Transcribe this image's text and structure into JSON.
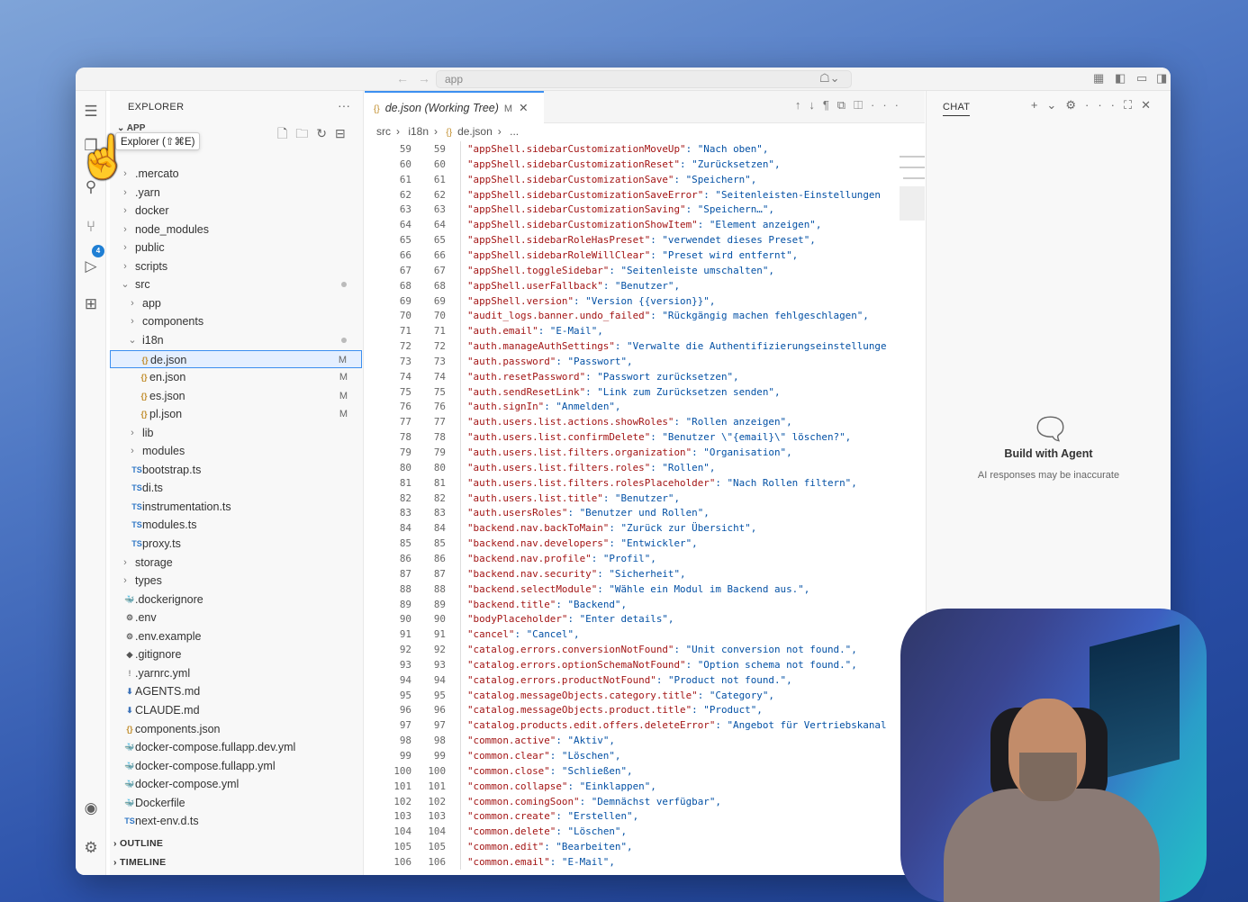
{
  "titlebar": {
    "search_text": "app",
    "nav_back": "←",
    "nav_forward": "→"
  },
  "tooltip": "Explorer (⇧⌘E)",
  "activity": {
    "scm_badge": "4"
  },
  "explorer": {
    "title": "EXPLORER",
    "folder": "APP",
    "items": [
      {
        "label": ".mercato",
        "type": "folder",
        "indent": 0
      },
      {
        "label": ".yarn",
        "type": "folder",
        "indent": 0
      },
      {
        "label": "docker",
        "type": "folder",
        "indent": 0
      },
      {
        "label": "node_modules",
        "type": "folder",
        "indent": 0
      },
      {
        "label": "public",
        "type": "folder",
        "indent": 0
      },
      {
        "label": "scripts",
        "type": "folder",
        "indent": 0
      },
      {
        "label": "src",
        "type": "folder-open",
        "indent": 0,
        "dot": true
      },
      {
        "label": "app",
        "type": "folder",
        "indent": 1
      },
      {
        "label": "components",
        "type": "folder",
        "indent": 1
      },
      {
        "label": "i18n",
        "type": "folder-open",
        "indent": 1,
        "dot": true
      },
      {
        "label": "de.json",
        "type": "json",
        "indent": 2,
        "status": "M",
        "selected": true
      },
      {
        "label": "en.json",
        "type": "json",
        "indent": 2,
        "status": "M"
      },
      {
        "label": "es.json",
        "type": "json",
        "indent": 2,
        "status": "M"
      },
      {
        "label": "pl.json",
        "type": "json",
        "indent": 2,
        "status": "M"
      },
      {
        "label": "lib",
        "type": "folder",
        "indent": 1
      },
      {
        "label": "modules",
        "type": "folder",
        "indent": 1
      },
      {
        "label": "bootstrap.ts",
        "type": "ts",
        "indent": 1
      },
      {
        "label": "di.ts",
        "type": "ts",
        "indent": 1
      },
      {
        "label": "instrumentation.ts",
        "type": "ts",
        "indent": 1
      },
      {
        "label": "modules.ts",
        "type": "ts",
        "indent": 1
      },
      {
        "label": "proxy.ts",
        "type": "ts",
        "indent": 1
      },
      {
        "label": "storage",
        "type": "folder",
        "indent": 0
      },
      {
        "label": "types",
        "type": "folder",
        "indent": 0
      },
      {
        "label": ".dockerignore",
        "type": "docker",
        "indent": 0
      },
      {
        "label": ".env",
        "type": "gear",
        "indent": 0
      },
      {
        "label": ".env.example",
        "type": "gear",
        "indent": 0
      },
      {
        "label": ".gitignore",
        "type": "git",
        "indent": 0
      },
      {
        "label": ".yarnrc.yml",
        "type": "yml",
        "indent": 0
      },
      {
        "label": "AGENTS.md",
        "type": "md",
        "indent": 0
      },
      {
        "label": "CLAUDE.md",
        "type": "md",
        "indent": 0
      },
      {
        "label": "components.json",
        "type": "json",
        "indent": 0
      },
      {
        "label": "docker-compose.fullapp.dev.yml",
        "type": "docker",
        "indent": 0
      },
      {
        "label": "docker-compose.fullapp.yml",
        "type": "docker",
        "indent": 0
      },
      {
        "label": "docker-compose.yml",
        "type": "docker",
        "indent": 0
      },
      {
        "label": "Dockerfile",
        "type": "docker",
        "indent": 0
      },
      {
        "label": "next-env.d.ts",
        "type": "ts",
        "indent": 0
      }
    ],
    "outline": "OUTLINE",
    "timeline": "TIMELINE"
  },
  "editor": {
    "tab_label": "de.json (Working Tree)",
    "tab_status": "M",
    "breadcrumb": [
      "src",
      "i18n",
      "de.json",
      "..."
    ],
    "lines": [
      {
        "n": "59",
        "k": "\"appShell.sidebarCustomizationMoveUp\"",
        "v": ": \"Nach oben\","
      },
      {
        "n": "60",
        "k": "\"appShell.sidebarCustomizationReset\"",
        "v": ": \"Zurücksetzen\","
      },
      {
        "n": "61",
        "k": "\"appShell.sidebarCustomizationSave\"",
        "v": ": \"Speichern\","
      },
      {
        "n": "62",
        "k": "\"appShell.sidebarCustomizationSaveError\"",
        "v": ": \"Seitenleisten-Einstellungen"
      },
      {
        "n": "63",
        "k": "\"appShell.sidebarCustomizationSaving\"",
        "v": ": \"Speichern…\","
      },
      {
        "n": "64",
        "k": "\"appShell.sidebarCustomizationShowItem\"",
        "v": ": \"Element anzeigen\","
      },
      {
        "n": "65",
        "k": "\"appShell.sidebarRoleHasPreset\"",
        "v": ": \"verwendet dieses Preset\","
      },
      {
        "n": "66",
        "k": "\"appShell.sidebarRoleWillClear\"",
        "v": ": \"Preset wird entfernt\","
      },
      {
        "n": "67",
        "k": "\"appShell.toggleSidebar\"",
        "v": ": \"Seitenleiste umschalten\","
      },
      {
        "n": "68",
        "k": "\"appShell.userFallback\"",
        "v": ": \"Benutzer\","
      },
      {
        "n": "69",
        "k": "\"appShell.version\"",
        "v": ": \"Version {{version}}\","
      },
      {
        "n": "70",
        "k": "\"audit_logs.banner.undo_failed\"",
        "v": ": \"Rückgängig machen fehlgeschlagen\","
      },
      {
        "n": "71",
        "k": "\"auth.email\"",
        "v": ": \"E-Mail\","
      },
      {
        "n": "72",
        "k": "\"auth.manageAuthSettings\"",
        "v": ": \"Verwalte die Authentifizierungseinstellunge"
      },
      {
        "n": "73",
        "k": "\"auth.password\"",
        "v": ": \"Passwort\","
      },
      {
        "n": "74",
        "k": "\"auth.resetPassword\"",
        "v": ": \"Passwort zurücksetzen\","
      },
      {
        "n": "75",
        "k": "\"auth.sendResetLink\"",
        "v": ": \"Link zum Zurücksetzen senden\","
      },
      {
        "n": "76",
        "k": "\"auth.signIn\"",
        "v": ": \"Anmelden\","
      },
      {
        "n": "77",
        "k": "\"auth.users.list.actions.showRoles\"",
        "v": ": \"Rollen anzeigen\","
      },
      {
        "n": "78",
        "k": "\"auth.users.list.confirmDelete\"",
        "v": ": \"Benutzer \\\"{email}\\\" löschen?\","
      },
      {
        "n": "79",
        "k": "\"auth.users.list.filters.organization\"",
        "v": ": \"Organisation\","
      },
      {
        "n": "80",
        "k": "\"auth.users.list.filters.roles\"",
        "v": ": \"Rollen\","
      },
      {
        "n": "81",
        "k": "\"auth.users.list.filters.rolesPlaceholder\"",
        "v": ": \"Nach Rollen filtern\","
      },
      {
        "n": "82",
        "k": "\"auth.users.list.title\"",
        "v": ": \"Benutzer\","
      },
      {
        "n": "83",
        "k": "\"auth.usersRoles\"",
        "v": ": \"Benutzer und Rollen\","
      },
      {
        "n": "84",
        "k": "\"backend.nav.backToMain\"",
        "v": ": \"Zurück zur Übersicht\","
      },
      {
        "n": "85",
        "k": "\"backend.nav.developers\"",
        "v": ": \"Entwickler\","
      },
      {
        "n": "86",
        "k": "\"backend.nav.profile\"",
        "v": ": \"Profil\","
      },
      {
        "n": "87",
        "k": "\"backend.nav.security\"",
        "v": ": \"Sicherheit\","
      },
      {
        "n": "88",
        "k": "\"backend.selectModule\"",
        "v": ": \"Wähle ein Modul im Backend aus.\","
      },
      {
        "n": "89",
        "k": "\"backend.title\"",
        "v": ": \"Backend\","
      },
      {
        "n": "90",
        "k": "\"bodyPlaceholder\"",
        "v": ": \"Enter details\","
      },
      {
        "n": "91",
        "k": "\"cancel\"",
        "v": ": \"Cancel\","
      },
      {
        "n": "92",
        "k": "\"catalog.errors.conversionNotFound\"",
        "v": ": \"Unit conversion not found.\","
      },
      {
        "n": "93",
        "k": "\"catalog.errors.optionSchemaNotFound\"",
        "v": ": \"Option schema not found.\","
      },
      {
        "n": "94",
        "k": "\"catalog.errors.productNotFound\"",
        "v": ": \"Product not found.\","
      },
      {
        "n": "95",
        "k": "\"catalog.messageObjects.category.title\"",
        "v": ": \"Category\","
      },
      {
        "n": "96",
        "k": "\"catalog.messageObjects.product.title\"",
        "v": ": \"Product\","
      },
      {
        "n": "97",
        "k": "\"catalog.products.edit.offers.deleteError\"",
        "v": ": \"Angebot für Vertriebskanal"
      },
      {
        "n": "98",
        "k": "\"common.active\"",
        "v": ": \"Aktiv\","
      },
      {
        "n": "99",
        "k": "\"common.clear\"",
        "v": ": \"Löschen\","
      },
      {
        "n": "100",
        "k": "\"common.close\"",
        "v": ": \"Schließen\","
      },
      {
        "n": "101",
        "k": "\"common.collapse\"",
        "v": ": \"Einklappen\","
      },
      {
        "n": "102",
        "k": "\"common.comingSoon\"",
        "v": ": \"Demnächst verfügbar\","
      },
      {
        "n": "103",
        "k": "\"common.create\"",
        "v": ": \"Erstellen\","
      },
      {
        "n": "104",
        "k": "\"common.delete\"",
        "v": ": \"Löschen\","
      },
      {
        "n": "105",
        "k": "\"common.edit\"",
        "v": ": \"Bearbeiten\","
      },
      {
        "n": "106",
        "k": "\"common.email\"",
        "v": ": \"E-Mail\","
      }
    ]
  },
  "chat": {
    "tab": "CHAT",
    "title": "Build with Agent",
    "subtitle": "AI responses may be inaccurate"
  },
  "colors": {
    "accent": "#3c8ff0",
    "key": "#a31515",
    "badge": "#1f7fd4"
  }
}
